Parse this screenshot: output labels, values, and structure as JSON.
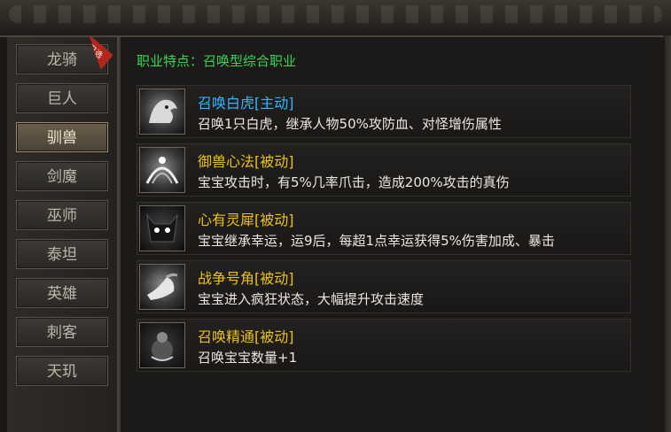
{
  "tabs": [
    {
      "label": "龙骑",
      "badge": "已选"
    },
    {
      "label": "巨人"
    },
    {
      "label": "驯兽"
    },
    {
      "label": "剑魔"
    },
    {
      "label": "巫师"
    },
    {
      "label": "泰坦"
    },
    {
      "label": "英雄"
    },
    {
      "label": "刺客"
    },
    {
      "label": "天玑"
    }
  ],
  "active_tab": "驯兽",
  "subtitle": "职业特点：召唤型综合职业",
  "skills": [
    {
      "title": "召唤白虎[主动]",
      "desc": "召唤1只白虎，继承人物50%攻防血、对怪增伤属性",
      "icon": "white-tiger-icon",
      "title_color": "#33b6ff"
    },
    {
      "title": "御兽心法[被动]",
      "desc": "宝宝攻击时，有5%几率爪击，造成200%攻击的真伤",
      "icon": "beast-mastery-icon",
      "title_color": "#e8c21b"
    },
    {
      "title": "心有灵犀[被动]",
      "desc": "宝宝继承幸运，运9后，每超1点幸运获得5%伤害加成、暴击",
      "icon": "demon-face-icon",
      "title_color": "#e8c21b"
    },
    {
      "title": "战争号角[被动]",
      "desc": "宝宝进入疯狂状态，大幅提升攻击速度",
      "icon": "war-horn-icon",
      "title_color": "#e8c21b"
    },
    {
      "title": "召唤精通[被动]",
      "desc": "召唤宝宝数量+1",
      "icon": "summon-mastery-icon",
      "title_color": "#e8c21b"
    }
  ]
}
